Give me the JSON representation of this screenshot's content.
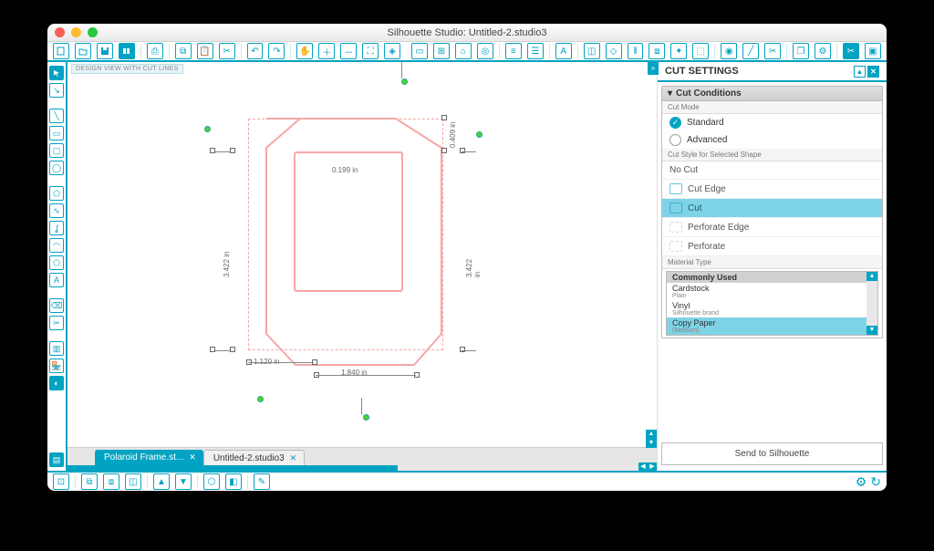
{
  "title": "Silhouette Studio: Untitled-2.studio3",
  "viewLabel": "DESIGN VIEW WITH CUT LINES",
  "tabs": [
    {
      "label": "Polaroid Frame.st...",
      "active": false
    },
    {
      "label": "Untitled-2.studio3",
      "active": true
    }
  ],
  "dimensions": {
    "leftHeight": "3.422 in",
    "rightHeight": "3.422 in",
    "bottomLeft": "1.120 in",
    "bottomCenter": "1.840 in",
    "topRight": "0.409 in",
    "innerTop": "0.199 in"
  },
  "panel": {
    "title": "CUT SETTINGS",
    "conditionsHeader": "Cut Conditions",
    "cutModeLabel": "Cut Mode",
    "modes": {
      "standard": "Standard",
      "advanced": "Advanced"
    },
    "selectedMode": "standard",
    "cutStyleLabel": "Cut Style for Selected Shape",
    "cutStyles": [
      "No Cut",
      "Cut Edge",
      "Cut",
      "Perforate Edge",
      "Perforate"
    ],
    "selectedCutStyle": "Cut",
    "materialTypeLabel": "Material Type",
    "materials": [
      {
        "label": "Commonly Used",
        "head": true
      },
      {
        "label": "Cardstock",
        "sub": "Plain"
      },
      {
        "label": "Vinyl",
        "sub": "Silhouette brand"
      },
      {
        "label": "Copy Paper",
        "sub": "(Medium)",
        "selected": true
      }
    ],
    "sendLabel": "Send to Silhouette"
  }
}
